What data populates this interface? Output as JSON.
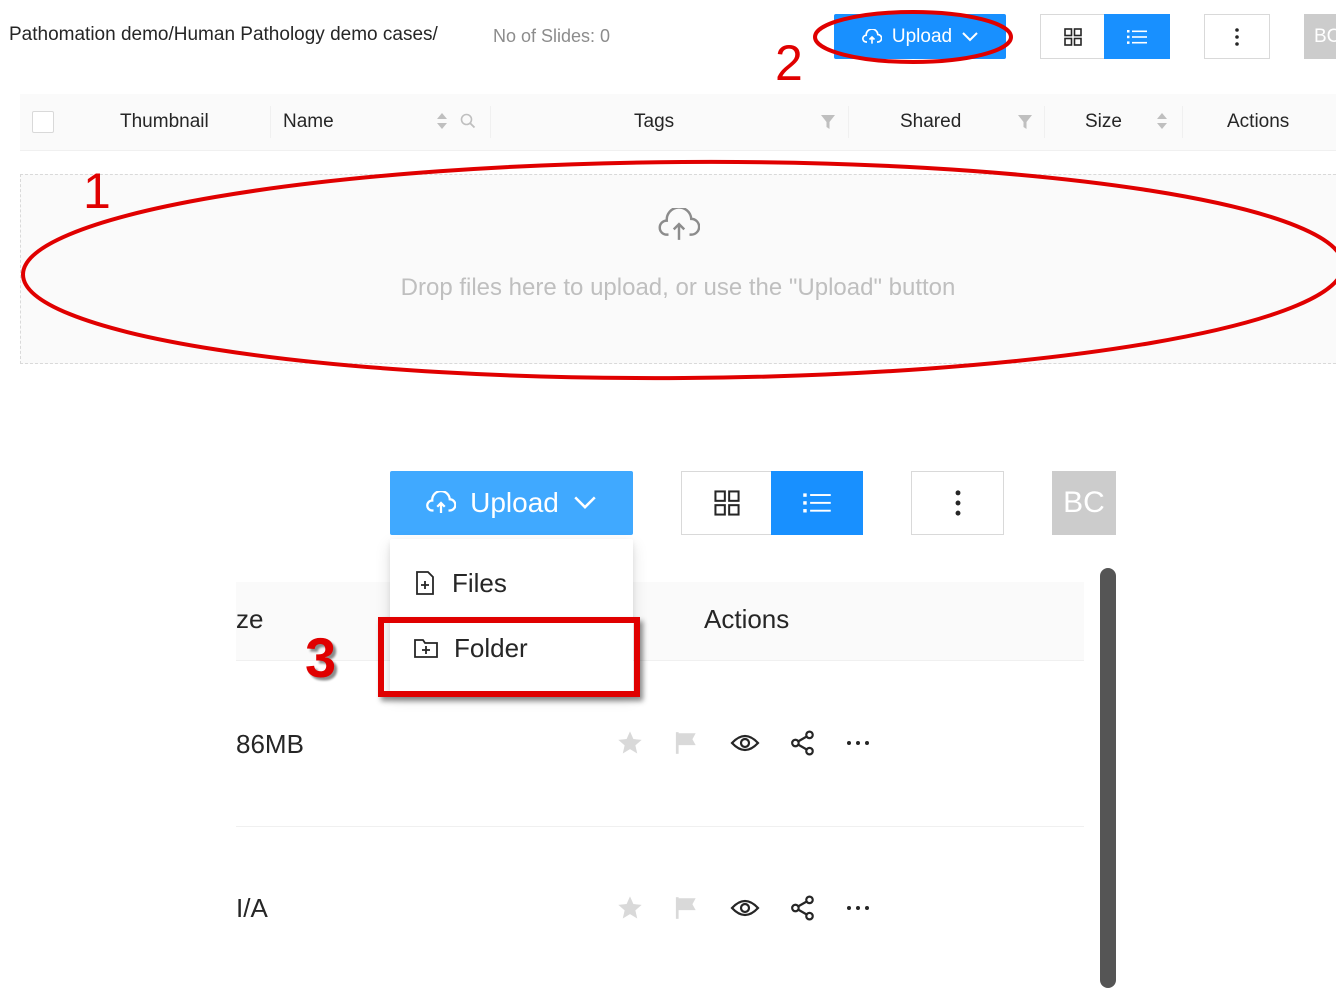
{
  "header": {
    "breadcrumb": "Pathomation demo/Human Pathology demo cases/",
    "slide_count": "No of Slides: 0",
    "upload_label": "Upload",
    "avatar_initials": "BC"
  },
  "table": {
    "columns": [
      "Thumbnail",
      "Name",
      "Tags",
      "Shared",
      "Size",
      "Actions"
    ]
  },
  "dropzone": {
    "text": "Drop files here to upload, or use the \"Upload\" button"
  },
  "zoomed": {
    "upload_label": "Upload",
    "avatar_initials": "BC",
    "menu": [
      "Files",
      "Folder"
    ],
    "header_size_fragment": "ze",
    "header_actions": "Actions",
    "rows": [
      {
        "size": "86MB"
      },
      {
        "size": "I/A"
      }
    ]
  },
  "annotations": [
    "1",
    "2",
    "3"
  ],
  "colors": {
    "primary": "#1890ff",
    "primary_light": "#40a9ff",
    "annotation_red": "#e00000",
    "avatar_gray": "#cccccc"
  },
  "icons": [
    "cloud-upload-icon",
    "chevron-down-icon",
    "grid-icon",
    "list-icon",
    "more-vertical-icon",
    "sort-icon",
    "search-icon",
    "filter-icon",
    "file-add-icon",
    "folder-add-icon",
    "star-icon",
    "flag-icon",
    "eye-icon",
    "share-icon",
    "more-horizontal-icon"
  ]
}
